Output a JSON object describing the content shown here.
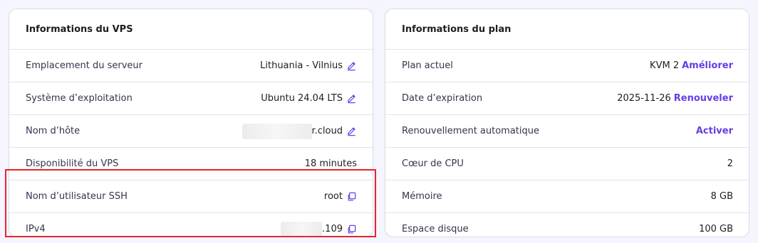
{
  "vps": {
    "title": "Informations du VPS",
    "location_label": "Emplacement du serveur",
    "location_value": "Lithuania - Vilnius",
    "os_label": "Système d’exploitation",
    "os_value": "Ubuntu 24.04 LTS",
    "hostname_label": "Nom d’hôte",
    "hostname_value": "r.cloud",
    "uptime_label": "Disponibilité du VPS",
    "uptime_value": "18 minutes",
    "ssh_label": "Nom d’utilisateur SSH",
    "ssh_value": "root",
    "ip_label": "IPv4",
    "ip_value": ".109"
  },
  "plan": {
    "title": "Informations du plan",
    "current_label": "Plan actuel",
    "current_value": "KVM 2",
    "upgrade_link": "Améliorer",
    "expiry_label": "Date d’expiration",
    "expiry_value": "2025-11-26",
    "renew_link": "Renouveler",
    "autorenew_label": "Renouvellement automatique",
    "autorenew_link": "Activer",
    "cpu_label": "Cœur de CPU",
    "cpu_value": "2",
    "memory_label": "Mémoire",
    "memory_value": "8 GB",
    "disk_label": "Espace disque",
    "disk_value": "100 GB"
  },
  "colors": {
    "accent": "#673de6",
    "highlight": "#e8242b"
  },
  "icons": {
    "edit": "pencil-icon",
    "copy": "copy-icon"
  }
}
